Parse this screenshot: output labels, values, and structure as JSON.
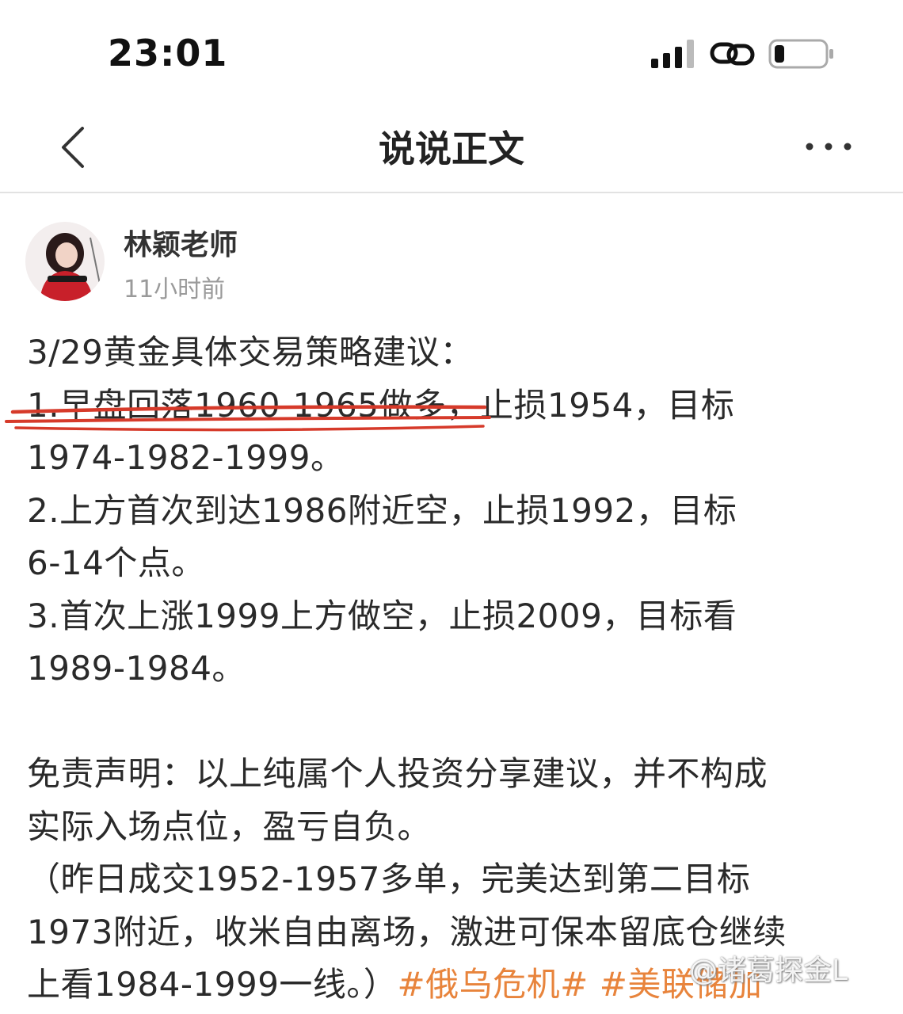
{
  "status_bar": {
    "time": "23:01",
    "icons": [
      "signal-icon",
      "link-icon",
      "battery-icon"
    ],
    "battery_level": 0.2
  },
  "nav": {
    "title": "说说正文",
    "back_icon": "chevron-left-icon",
    "more_icon": "more-horizontal-icon"
  },
  "author": {
    "name": "林颖老师",
    "time": "11小时前"
  },
  "post": {
    "lines": [
      "3/29黄金具体交易策略建议：",
      "1.早盘回落1960-1965做多，止损1954，目标",
      "1974-1982-1999。",
      "2.上方首次到达1986附近空，止损1992，目标",
      "6-14个点。",
      "3.首次上涨1999上方做空，止损2009，目标看",
      "1989-1984。",
      "",
      "免责声明：以上纯属个人投资分享建议，并不构成",
      "实际入场点位，盈亏自负。",
      "（昨日成交1952-1957多单，完美达到第二目标",
      "1973附近，收米自由离场，激进可保本留底仓继续",
      "上看1984-1999一线。）"
    ],
    "hashtags": [
      "#俄乌危机#",
      "#美联储加"
    ]
  },
  "annotation_color": "#d63a2a",
  "hashtag_color": "#e8843c",
  "watermark": "@诸葛探金L"
}
